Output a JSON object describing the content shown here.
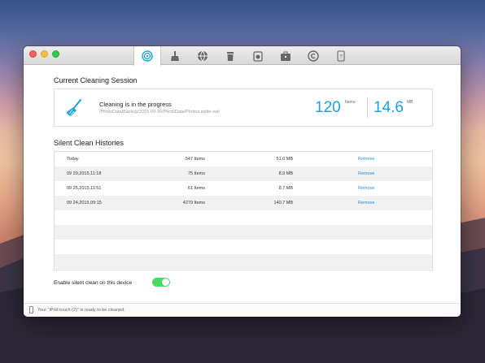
{
  "colors": {
    "accent": "#1da1e0",
    "link": "#1e8fd8",
    "toggle_on": "#4cd964"
  },
  "toolbar": {
    "tools": [
      {
        "icon": "speed-clean-icon",
        "active": true
      },
      {
        "icon": "broom-icon",
        "active": false
      },
      {
        "icon": "globe-icon",
        "active": false
      },
      {
        "icon": "trash-icon",
        "active": false
      },
      {
        "icon": "archive-icon",
        "active": false
      },
      {
        "icon": "toolbox-icon",
        "active": false
      },
      {
        "icon": "copyright-icon",
        "active": false
      },
      {
        "icon": "device-help-icon",
        "active": false
      }
    ]
  },
  "session": {
    "title": "Current Cleaning Session",
    "status": "Cleaning is in the progress",
    "path": "/PhotoData/Backup/2015-09-30/PhotoData/Photos.sqlite-wal",
    "items_count": "120",
    "items_unit": "Items",
    "size_value": "14.6",
    "size_unit": "MB"
  },
  "histories": {
    "title": "Silent Clean Histories",
    "rows": [
      {
        "date": "Today",
        "items": "547 Items",
        "size": "51.0 MB",
        "action": "Remove"
      },
      {
        "date": "09 29,2015,11:18",
        "items": "75 Items",
        "size": "8.9 MB",
        "action": "Remove"
      },
      {
        "date": "09 25,2015,11:51",
        "items": "61 Items",
        "size": "8.7 MB",
        "action": "Remove"
      },
      {
        "date": "09 24,2015,09:15",
        "items": "4279 Items",
        "size": "140.7 MB",
        "action": "Remove"
      }
    ],
    "empty_rows": 4
  },
  "silent_clean": {
    "label": "Enable silent clean on this device",
    "enabled": true
  },
  "statusbar": {
    "text": "Your \"iPod touch (2)\" is ready to be cleaned."
  }
}
